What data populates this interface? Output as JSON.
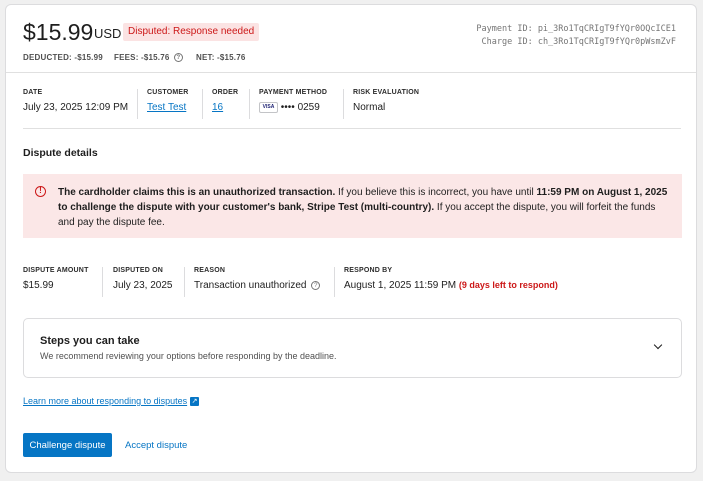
{
  "header": {
    "amount": "$15.99",
    "currency": "USD",
    "status_badge": "Disputed: Response needed",
    "deducted": "DEDUCTED: -$15.99",
    "fees": "FEES: -$15.76",
    "net": "NET: -$15.76",
    "payment_id": "Payment ID: pi_3Ro1TqCRIgT9fYQr0OQcICE1",
    "charge_id": "Charge ID: ch_3Ro1TqCRIgT9fYQr0pWsmZvF"
  },
  "meta": {
    "date_label": "DATE",
    "date_value": "July 23, 2025 12:09 PM",
    "customer_label": "CUSTOMER",
    "customer_value": "Test Test",
    "order_label": "ORDER",
    "order_value": "16",
    "payment_label": "PAYMENT METHOD",
    "card_brand": "VISA",
    "payment_value": "•••• 0259",
    "risk_label": "RISK EVALUATION",
    "risk_value": "Normal"
  },
  "dispute": {
    "section_title": "Dispute details",
    "alert_bold1": "The cardholder claims this is an unauthorized transaction.",
    "alert_text1": " If you believe this is incorrect, you have until ",
    "alert_bold2": "11:59 PM on August 1, 2025 to challenge the dispute with your customer's bank, Stripe Test (multi-country).",
    "alert_text2": " If you accept the dispute, you will forfeit the funds and pay the dispute fee.",
    "amount_label": "DISPUTE AMOUNT",
    "amount_value": "$15.99",
    "disputed_on_label": "DISPUTED ON",
    "disputed_on_value": "July 23, 2025",
    "reason_label": "REASON",
    "reason_value": "Transaction unauthorized",
    "respond_label": "RESPOND BY",
    "respond_value": "August 1, 2025 11:59 PM",
    "respond_remaining": "(9 days left to respond)"
  },
  "steps": {
    "title": "Steps you can take",
    "subtitle": "We recommend reviewing your options before responding by the deadline."
  },
  "learn_link": "Learn more about responding to disputes",
  "actions": {
    "challenge": "Challenge dispute",
    "accept": "Accept dispute"
  }
}
